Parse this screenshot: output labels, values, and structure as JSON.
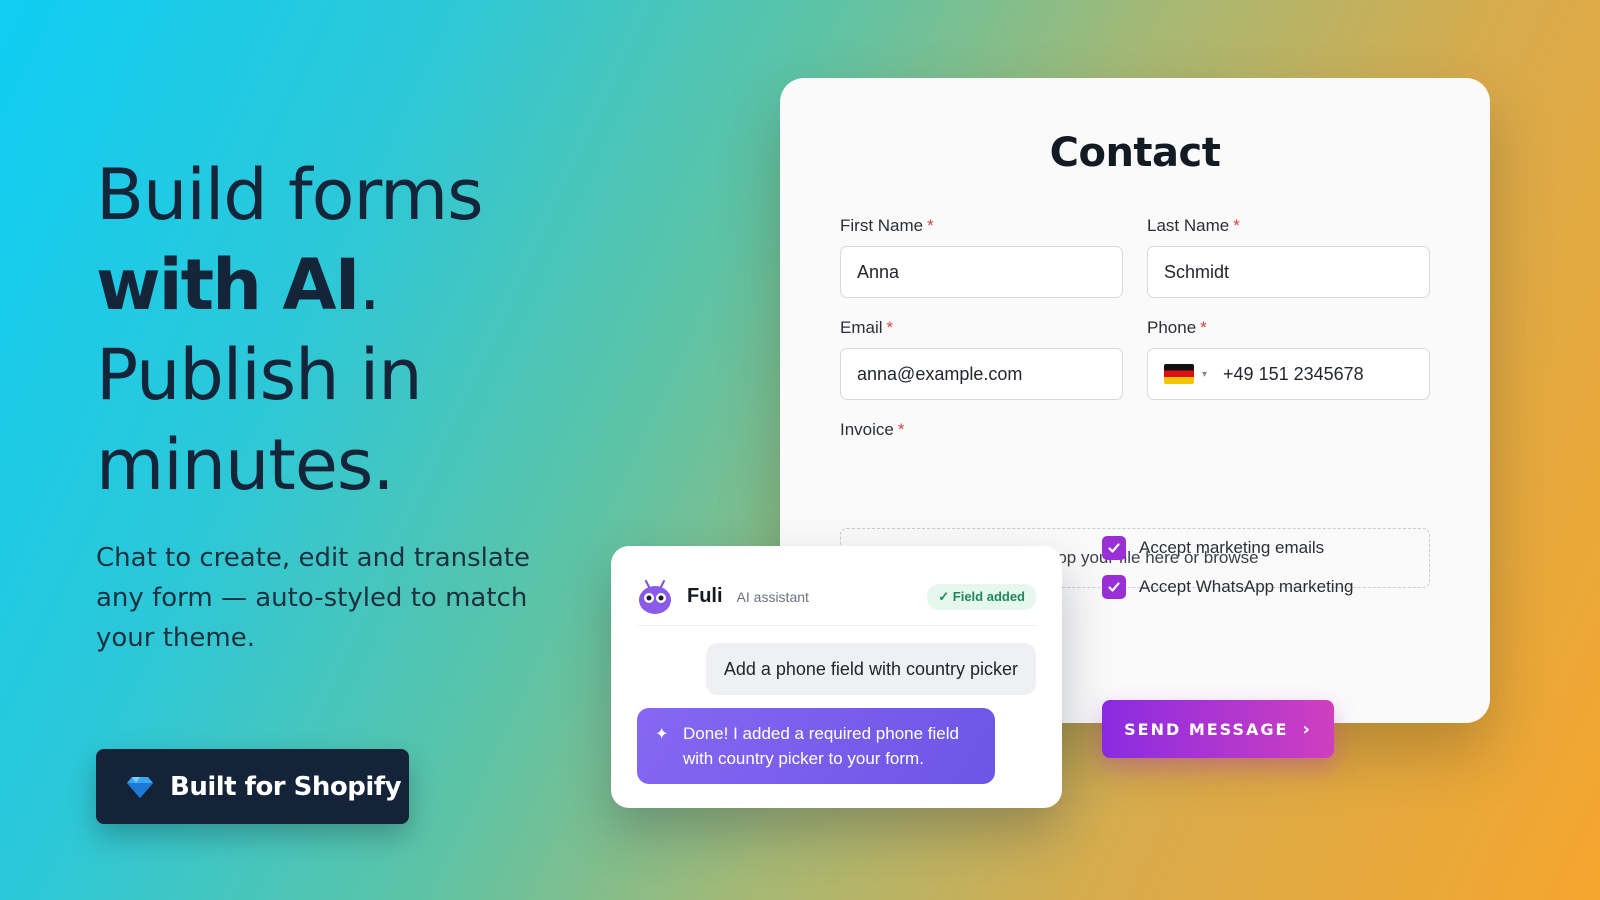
{
  "hero": {
    "line1": "Build forms",
    "line2_bold": "with AI",
    "line2_tail": ".",
    "line3": "Publish in",
    "line4": "minutes.",
    "subtitle": "Chat to create, edit and translate any form — auto-styled to match your theme.",
    "cta_label": "Built for Shopify"
  },
  "form": {
    "title": "Contact",
    "required_mark": "*",
    "first_name": {
      "label": "First Name",
      "value": "Anna"
    },
    "last_name": {
      "label": "Last Name",
      "value": "Schmidt"
    },
    "email": {
      "label": "Email",
      "value": "anna@example.com"
    },
    "phone": {
      "label": "Phone",
      "country": "DE",
      "caret": "▾",
      "value": "+49 151 2345678"
    },
    "invoice": {
      "label": "Invoice",
      "dropzone": "Drop your file here or browse"
    },
    "checkboxes": [
      {
        "label": "Accept marketing emails",
        "checked": true
      },
      {
        "label": "Accept WhatsApp marketing",
        "checked": true
      }
    ],
    "submit_label": "SEND MESSAGE",
    "submit_icon": "›"
  },
  "chat": {
    "assistant_name": "Fuli",
    "assistant_role": "AI assistant",
    "badge": "✓ Field added",
    "user_message": "Add a phone field with country picker",
    "ai_icon": "✦",
    "ai_message": "Done! I added a required phone field with country picker to your form."
  },
  "colors": {
    "accent": "#9b2fd6",
    "button_dark": "#142338",
    "ai_bubble": "#7a5ff0",
    "badge_green": "#1f8a57"
  }
}
